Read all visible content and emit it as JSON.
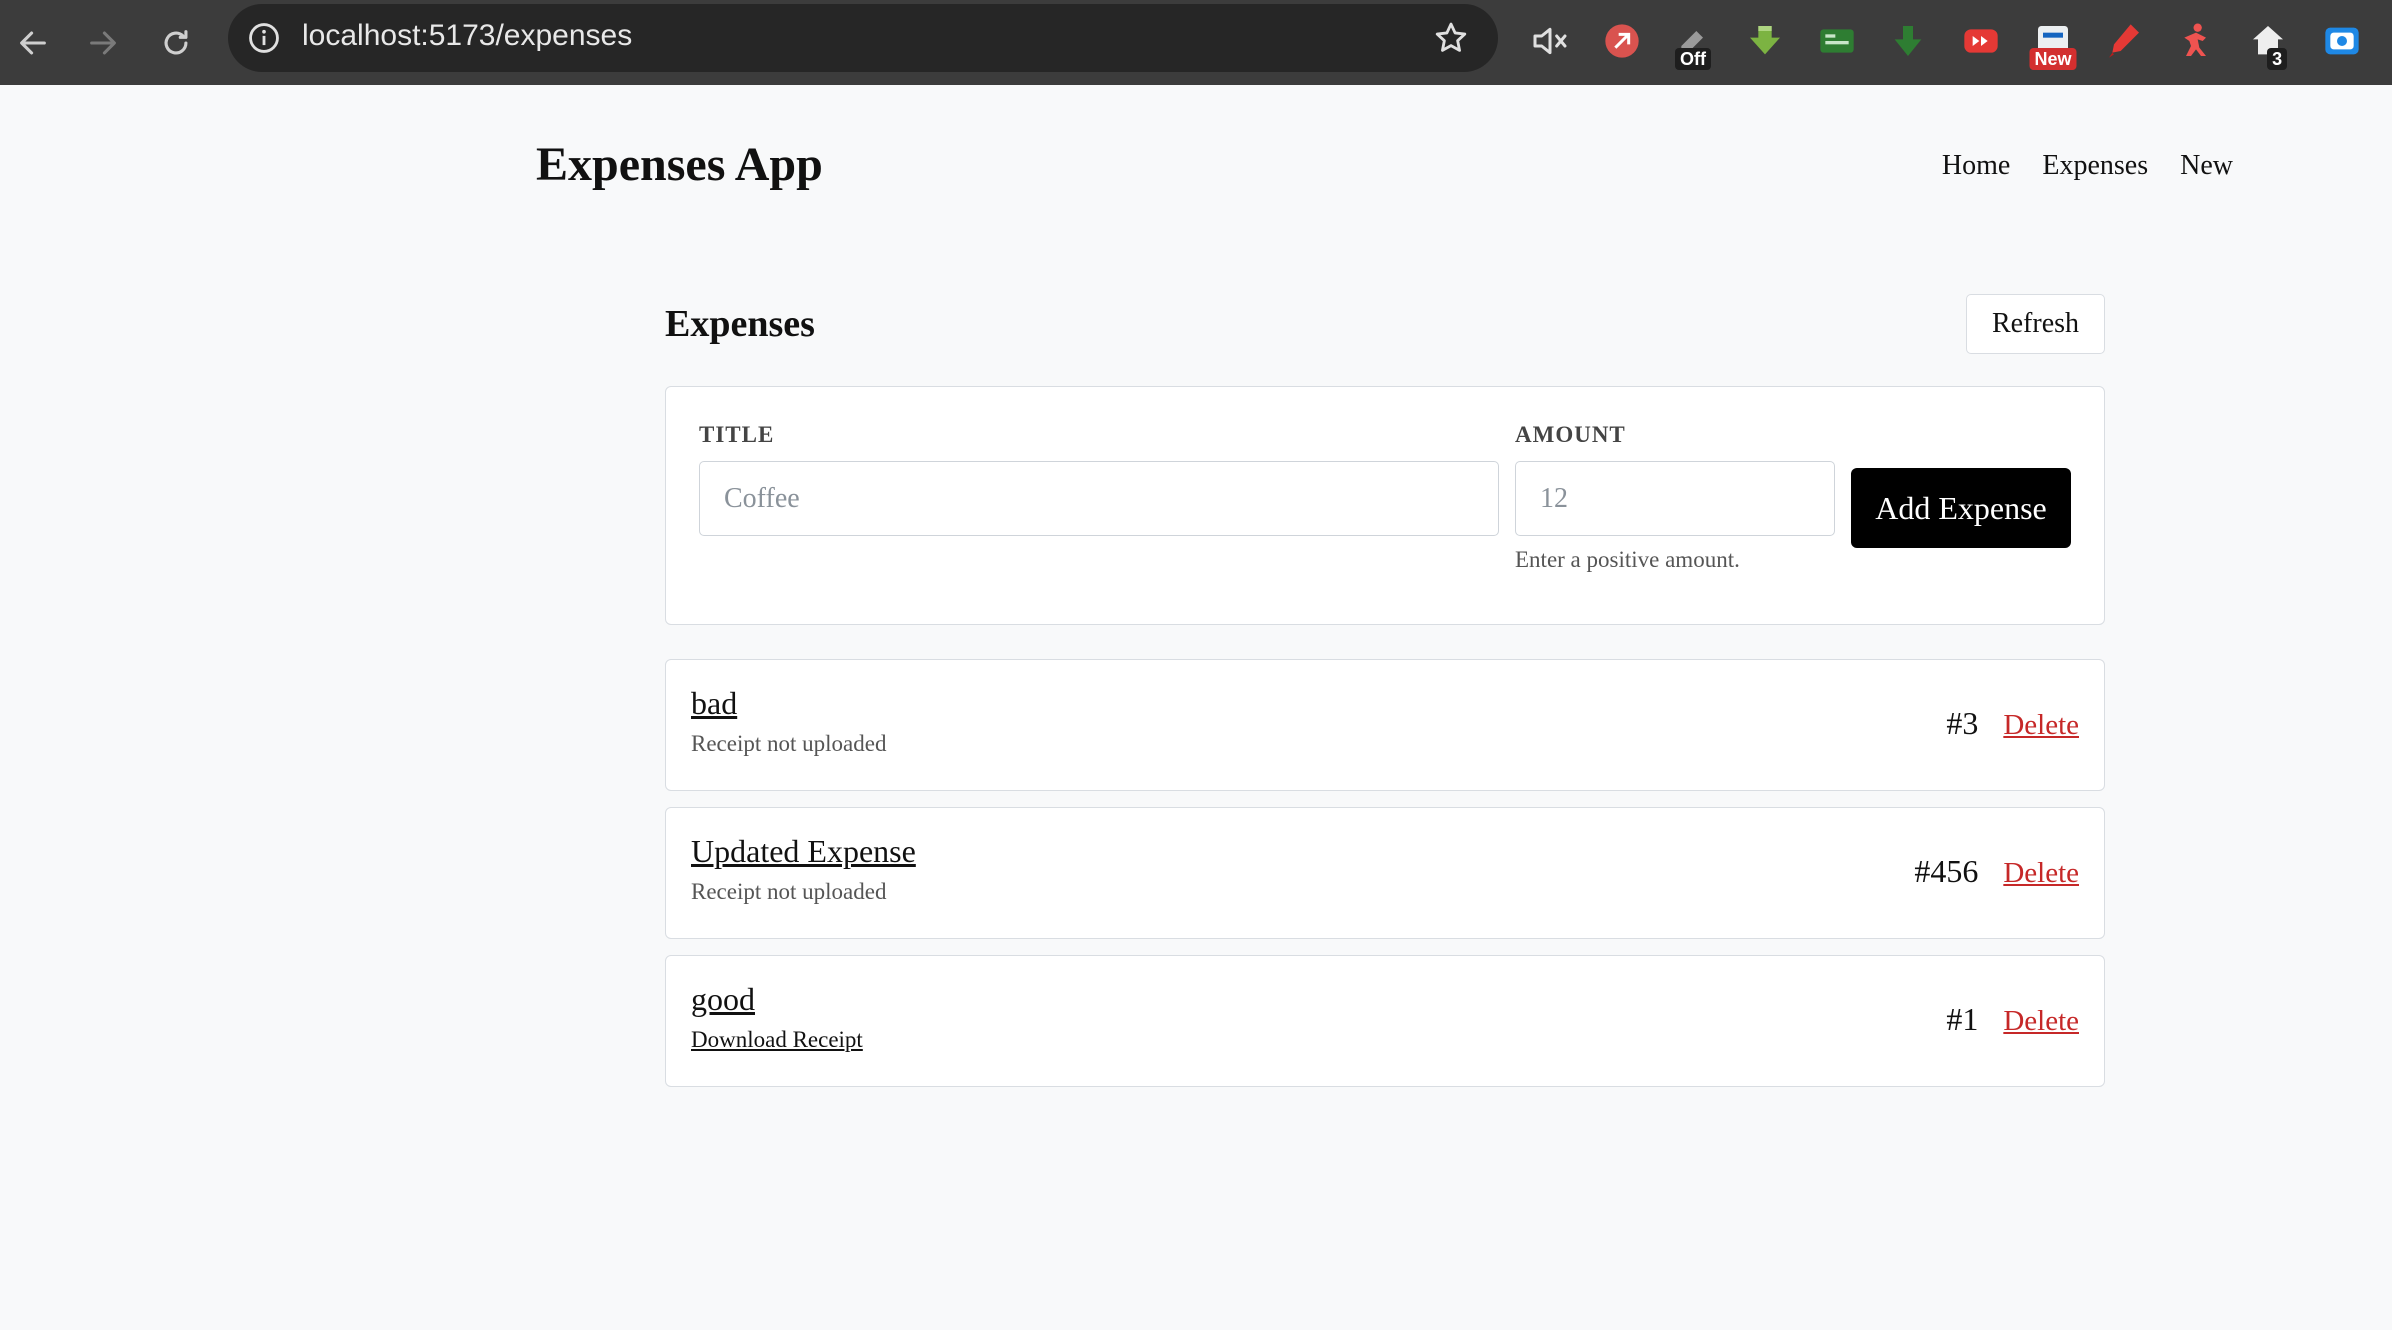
{
  "browser": {
    "url": "localhost:5173/expenses",
    "extensions": [
      {
        "icon": "mute-icon",
        "badge": ""
      },
      {
        "icon": "red-circle-extension-icon",
        "badge": ""
      },
      {
        "icon": "pen-extension-icon",
        "badge": "Off"
      },
      {
        "icon": "green-download-icon",
        "badge": ""
      },
      {
        "icon": "green-card-extension-icon",
        "badge": ""
      },
      {
        "icon": "green-arrow-down-icon",
        "badge": ""
      },
      {
        "icon": "red-fastforward-icon",
        "badge": ""
      },
      {
        "icon": "news-extension-icon",
        "badge": "New"
      },
      {
        "icon": "red-marker-icon",
        "badge": ""
      },
      {
        "icon": "red-figure-icon",
        "badge": ""
      },
      {
        "icon": "house-extension-icon",
        "badge": "3"
      },
      {
        "icon": "screen-record-icon",
        "badge": ""
      }
    ],
    "colors": {
      "toolbar": "#3c3c3c",
      "omnibox": "#262626"
    }
  },
  "header": {
    "app_title": "Expenses App",
    "nav": [
      "Home",
      "Expenses",
      "New"
    ]
  },
  "main": {
    "section_title": "Expenses",
    "refresh_label": "Refresh",
    "form": {
      "title_label": "TITLE",
      "title_placeholder": "Coffee",
      "title_value": "",
      "amount_label": "AMOUNT",
      "amount_placeholder": "12",
      "amount_value": "",
      "amount_hint": "Enter a positive amount.",
      "submit_label": "Add Expense"
    },
    "expenses": [
      {
        "title": "bad",
        "receipt": "Receipt not uploaded",
        "receipt_is_link": false,
        "id": "#3",
        "delete_label": "Delete"
      },
      {
        "title": "Updated Expense",
        "receipt": "Receipt not uploaded",
        "receipt_is_link": false,
        "id": "#456",
        "delete_label": "Delete"
      },
      {
        "title": "good",
        "receipt": "Download Receipt",
        "receipt_is_link": true,
        "id": "#1",
        "delete_label": "Delete"
      }
    ]
  },
  "colors": {
    "background": "#f8f9fa",
    "primary_button": "#000000",
    "delete": "#c62828",
    "border": "#d9dde2"
  }
}
